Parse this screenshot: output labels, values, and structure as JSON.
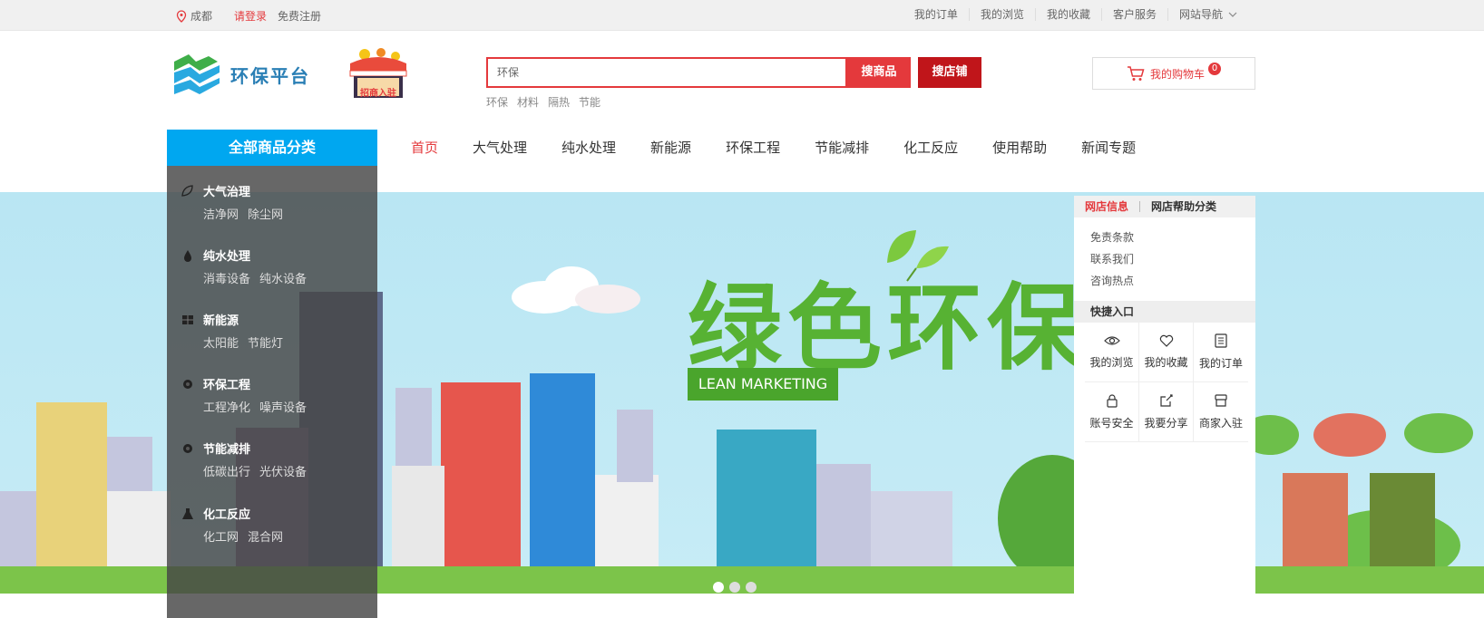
{
  "topbar": {
    "location": "成都",
    "login": "请登录",
    "register": "免费注册",
    "links": [
      "我的订单",
      "我的浏览",
      "我的收藏",
      "客户服务"
    ],
    "site_nav": "网站导航"
  },
  "header": {
    "logo_text": "环保平台",
    "merchant_badge": "招商入驻",
    "search_value": "环保",
    "search_goods_btn": "搜商品",
    "search_shop_btn": "搜店铺",
    "hot_words": [
      "环保",
      "材料",
      "隔热",
      "节能"
    ],
    "cart_label": "我的购物车",
    "cart_count": "0"
  },
  "nav": {
    "all_categories": "全部商品分类",
    "items": [
      "首页",
      "大气处理",
      "纯水处理",
      "新能源",
      "环保工程",
      "节能减排",
      "化工反应",
      "使用帮助",
      "新闻专题"
    ]
  },
  "categories": [
    {
      "title": "大气治理",
      "subs": [
        "洁净网",
        "除尘网"
      ],
      "icon": "leaf-icon"
    },
    {
      "title": "纯水处理",
      "subs": [
        "消毒设备",
        "纯水设备"
      ],
      "icon": "water-drop-icon"
    },
    {
      "title": "新能源",
      "subs": [
        "太阳能",
        "节能灯"
      ],
      "icon": "solar-icon"
    },
    {
      "title": "环保工程",
      "subs": [
        "工程净化",
        "噪声设备"
      ],
      "icon": "gear-icon"
    },
    {
      "title": "节能减排",
      "subs": [
        "低碳出行",
        "光伏设备"
      ],
      "icon": "gear-icon"
    },
    {
      "title": "化工反应",
      "subs": [
        "化工网",
        "混合网"
      ],
      "icon": "flask-icon"
    }
  ],
  "banner": {
    "headline": "绿色环保",
    "tagline": "LEAN MARKETING",
    "slides": 3,
    "active_slide": 1
  },
  "side_panel": {
    "tabs": [
      "网店信息",
      "网店帮助分类"
    ],
    "links": [
      "免责条款",
      "联系我们",
      "咨询热点"
    ],
    "quick_title": "快捷入口",
    "quick_items": [
      {
        "label": "我的浏览",
        "icon": "eye-icon"
      },
      {
        "label": "我的收藏",
        "icon": "heart-icon"
      },
      {
        "label": "我的订单",
        "icon": "order-list-icon"
      },
      {
        "label": "账号安全",
        "icon": "lock-icon"
      },
      {
        "label": "我要分享",
        "icon": "share-icon"
      },
      {
        "label": "商家入驻",
        "icon": "store-icon"
      }
    ]
  },
  "colors": {
    "accent": "#e4393c",
    "category_blue": "#00a7f0",
    "dark_red": "#c0151a"
  }
}
